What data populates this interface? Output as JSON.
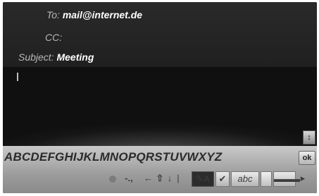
{
  "header": {
    "to_label": "To:",
    "to_value": "mail@internet.de",
    "cc_label": "CC:",
    "subject_label": "Subject:",
    "subject_value": "Meeting"
  },
  "editor": {
    "cursor_text": ""
  },
  "side_button": {
    "icon": "options-icon",
    "label": "↕"
  },
  "keyboard": {
    "letters": "ABCDEFGHIJKLMNOPQRSTUVWXYZ",
    "ok_label": "ok",
    "punctuation_label": "-.,",
    "left_arrow_label": "←",
    "shift_label": "⇧",
    "down_label": "↓",
    "separator_label": "|",
    "pen_label": "✎A",
    "check_label": "✔",
    "abc_label": "abc",
    "tele_label": "▬▬▬"
  },
  "colors": {
    "background": "#121212",
    "keyboard_bar": "#b0b0b0",
    "text_light": "#ffffff"
  }
}
